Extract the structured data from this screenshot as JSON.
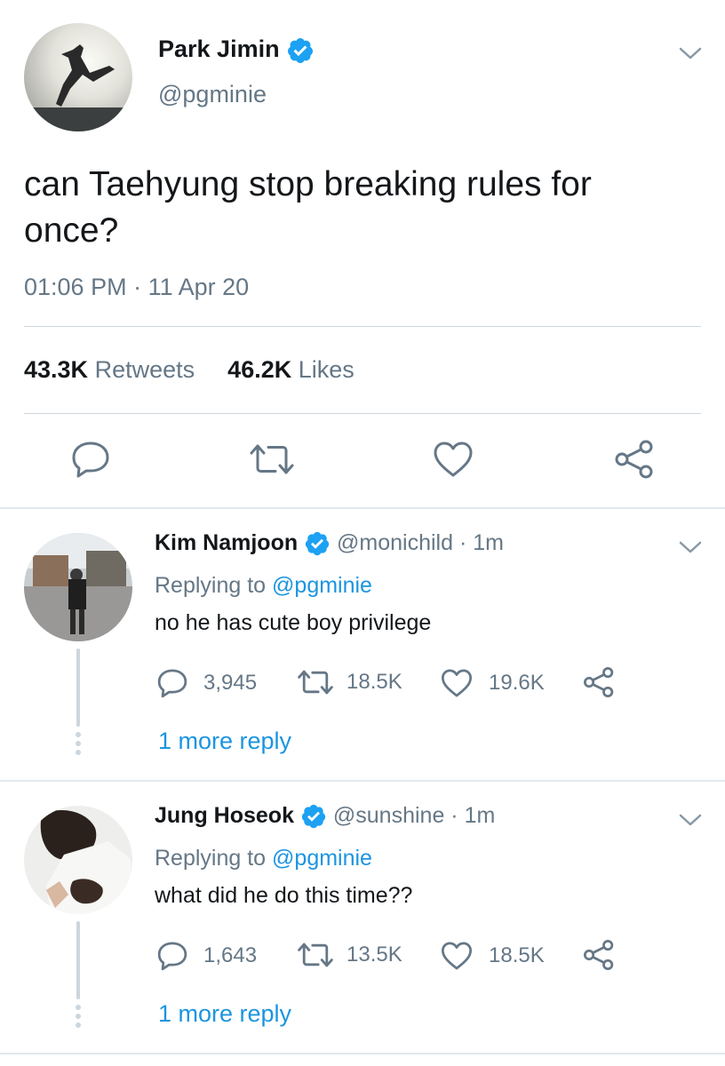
{
  "main_tweet": {
    "author_name": "Park Jimin",
    "handle": "@pgminie",
    "text": "can Taehyung stop breaking rules for once?",
    "time": "01:06 PM",
    "separator": "·",
    "date": "11 Apr 20",
    "retweets_count": "43.3K",
    "retweets_label": "Retweets",
    "likes_count": "46.2K",
    "likes_label": "Likes"
  },
  "replies": [
    {
      "author_name": "Kim Namjoon",
      "handle": "@monichild",
      "separator": "·",
      "age": "1m",
      "replying_prefix": "Replying to",
      "replying_handle": "@pgminie",
      "text": "no he has cute boy privilege",
      "reply_count": "3,945",
      "retweet_count": "18.5K",
      "like_count": "19.6K",
      "more_replies": "1 more reply"
    },
    {
      "author_name": "Jung Hoseok",
      "handle": "@sunshine",
      "separator": "·",
      "age": "1m",
      "replying_prefix": "Replying to",
      "replying_handle": "@pgminie",
      "text": "what did he do this time??",
      "reply_count": "1,643",
      "retweet_count": "13.5K",
      "like_count": "18.5K",
      "more_replies": "1 more reply"
    }
  ],
  "icons": [
    "verified-badge-icon",
    "chevron-down-icon",
    "reply-icon",
    "retweet-icon",
    "like-icon",
    "share-icon"
  ],
  "colors": {
    "text": "#14171a",
    "secondary": "#657786",
    "link": "#1b95e0",
    "verified": "#1da1f2",
    "divider": "#ccd6dd"
  }
}
